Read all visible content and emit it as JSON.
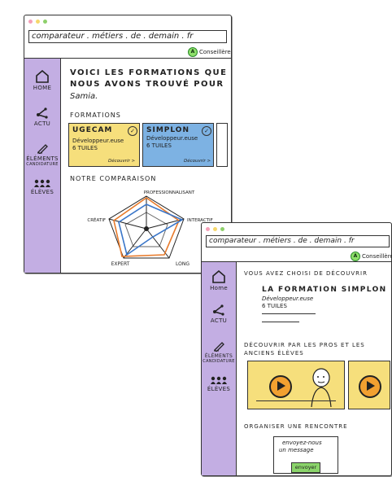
{
  "colors": {
    "sidebar": "#c3aee3",
    "card_ugecam": "#f6df7c",
    "card_simplon": "#7db2e3",
    "chart_orange": "#e87b2c",
    "chart_blue": "#3a76c9",
    "video": "#f6df7c",
    "play": "#f2a030",
    "send": "#8ad46a",
    "consultant": "#8ee06a"
  },
  "win1": {
    "url": "comparateur . métiers . de . demain . fr",
    "conseillere": "Conseillère",
    "nav": {
      "home": "HOME",
      "actu": "ACTU",
      "elements": "ÉLÉMENTS",
      "elements2": "CANDIDATURE",
      "eleves": "ÉLÈVES"
    },
    "heading1": "VOICI LES FORMATIONS QUE",
    "heading2": "NOUS AVONS TROUVÉ POUR",
    "heading_name": "Samia.",
    "formations_title": "FORMATIONS",
    "cards": [
      {
        "title": "UGECAM",
        "line1": "Développeur.euse",
        "line2": "6 TUILES",
        "link": "Découvrir >"
      },
      {
        "title": "SIMPLON",
        "line1": "Développeur.euse",
        "line2": "6 TUILES",
        "link": "Découvrir >"
      }
    ],
    "comparison_title": "NOTRE COMPARAISON",
    "radar_labels": {
      "top": "PROFESSIONNALISANT",
      "right": "INTERACTIF",
      "bottom_right": "LONG",
      "bottom_left": "EXPERT",
      "left": "CRÉATIF"
    }
  },
  "win2": {
    "url": "comparateur . métiers . de . demain . fr",
    "conseillere": "Conseillère",
    "nav": {
      "home": "Home",
      "actu": "ACTU",
      "elements": "ÉLÉMENTS",
      "elements2": "CANDIDATURE",
      "eleves": "ÉLÈVES"
    },
    "intro": "VOUS AVEZ CHOISI DE DÉCOUVRIR",
    "formation_title": "LA FORMATION SIMPLON",
    "line1": "Développeur.euse",
    "line2": "6 TUILES",
    "discover1": "DÉCOUVRIR PAR LES PROS ET LES",
    "discover2": "ANCIENS ÉLÈVES",
    "meet_title": "ORGANISER UNE RENCONTRE",
    "msg1": "envoyez-nous",
    "msg2": "un message",
    "send": "envoyer"
  }
}
